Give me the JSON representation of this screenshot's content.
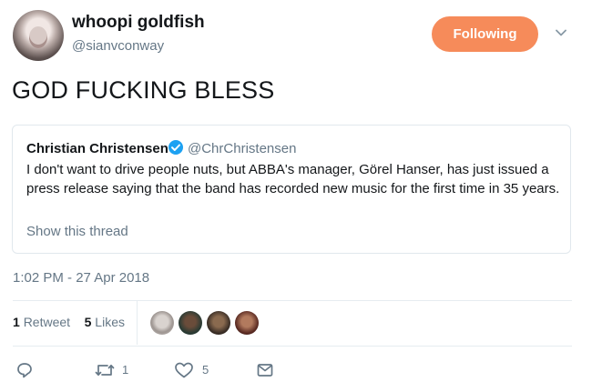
{
  "author": {
    "display_name": "whoopi goldfish",
    "handle": "@sianvconway"
  },
  "follow_button": "Following",
  "tweet_text": "GOD FUCKING BLESS",
  "quoted": {
    "name": "Christian Christensen",
    "handle": "@ChrChristensen",
    "text": "I don't want to drive people nuts, but ABBA's manager, Görel Hanser, has just issued a press release saying that the band has recorded new music for the first time in 35 years.",
    "thread_link": "Show this thread"
  },
  "timestamp": "1:02 PM - 27 Apr 2018",
  "stats": {
    "retweets_count": "1",
    "retweets_label": "Retweet",
    "likes_count": "5",
    "likes_label": "Likes"
  },
  "actions": {
    "retweet_count": "1",
    "like_count": "5"
  },
  "colors": {
    "accent": "#f68b5a",
    "verified": "#1da1f2",
    "muted": "#657786"
  }
}
